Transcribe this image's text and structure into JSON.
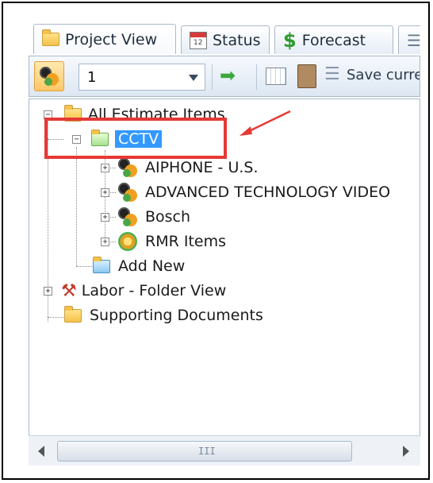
{
  "tabs": [
    {
      "label": "Project View",
      "icon": "folder-icon"
    },
    {
      "label": "Status",
      "icon": "calendar-icon"
    },
    {
      "label": "Forecast",
      "icon": "dollar-icon"
    },
    {
      "label": "",
      "icon": "list-icon"
    }
  ],
  "toolbar": {
    "combo_value": "1",
    "save_text": "Save curre"
  },
  "tree": {
    "root": "All Estimate Items",
    "cctv": "CCTV",
    "children": [
      "AIPHONE - U.S.",
      "ADVANCED TECHNOLOGY VIDEO",
      "Bosch",
      "RMR Items"
    ],
    "add_new": "Add New",
    "labor": "Labor - Folder View",
    "supporting": "Supporting Documents"
  },
  "colors": {
    "highlight": "#e53935",
    "selection": "#3399ff"
  },
  "scrollbar": {
    "grip": "III"
  }
}
